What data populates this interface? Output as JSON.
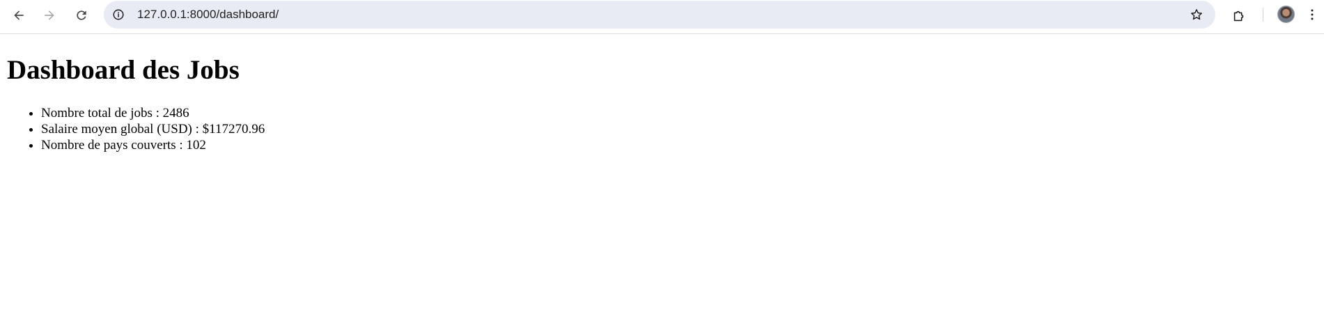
{
  "browser": {
    "url": "127.0.0.1:8000/dashboard/",
    "icons": {
      "back": "back-arrow-icon",
      "forward": "forward-arrow-icon",
      "reload": "reload-icon",
      "site_info": "info-icon",
      "bookmark": "star-icon",
      "extensions": "puzzle-icon",
      "menu": "kebab-menu-icon"
    }
  },
  "page": {
    "title": "Dashboard des Jobs",
    "stats": [
      "Nombre total de jobs : 2486",
      "Salaire moyen global (USD) : $117270.96",
      "Nombre de pays couverts : 102"
    ]
  }
}
